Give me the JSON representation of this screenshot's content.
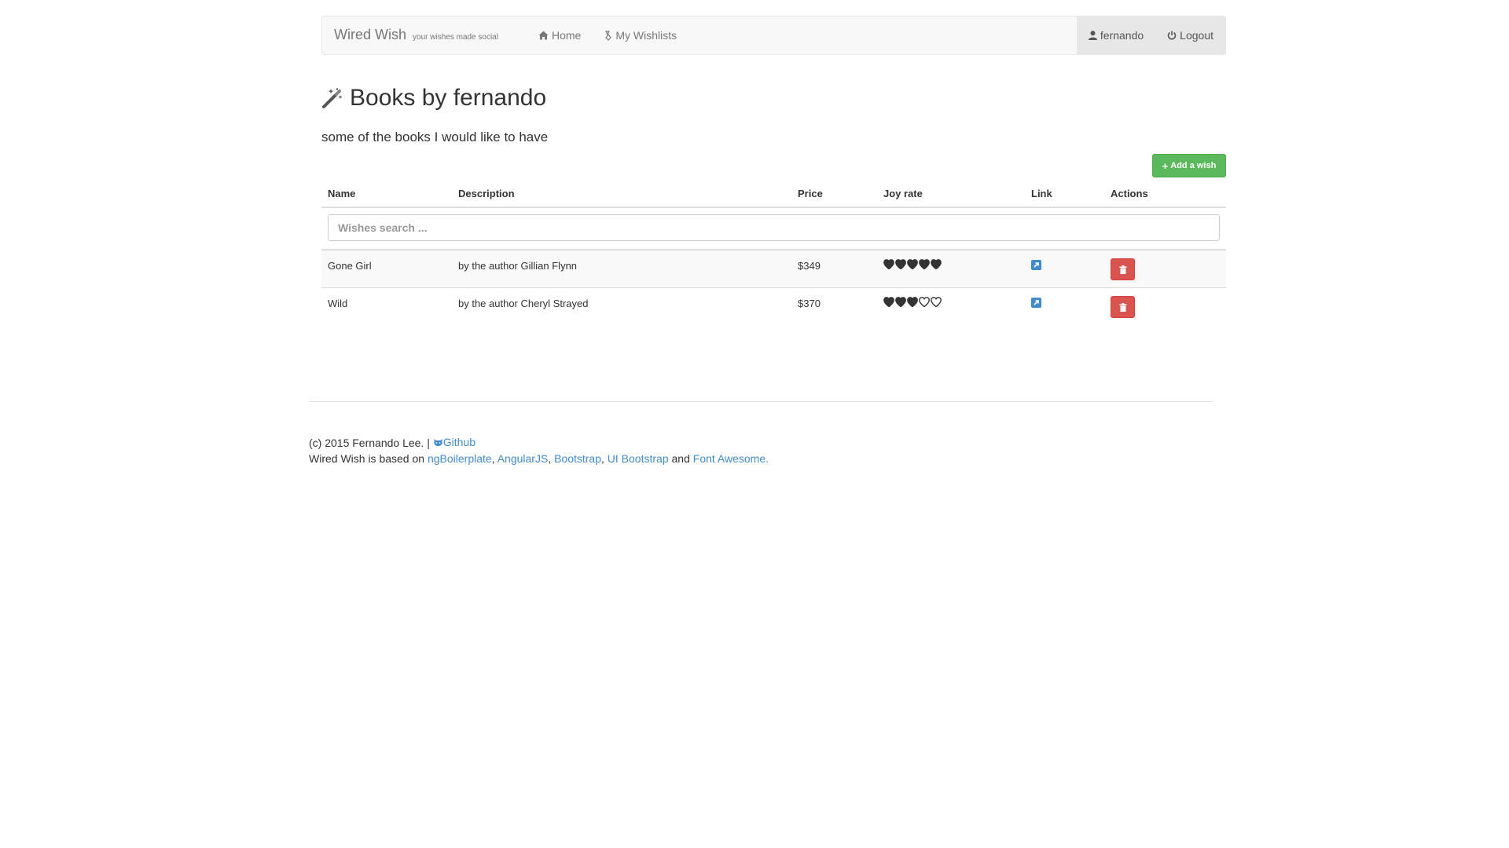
{
  "navbar": {
    "brand": "Wired Wish",
    "tagline": "your wishes made social",
    "home": "Home",
    "my_wishlists": "My Wishlists",
    "user": "fernando",
    "logout": "Logout"
  },
  "page": {
    "title": "Books by fernando",
    "description": "some of the books I would like to have",
    "add_button": "Add a wish"
  },
  "table": {
    "headers": {
      "name": "Name",
      "description": "Description",
      "price": "Price",
      "joy_rate": "Joy rate",
      "link": "Link",
      "actions": "Actions"
    },
    "search_placeholder": "Wishes search ...",
    "rows": [
      {
        "name": "Gone Girl",
        "description": "by the author Gillian Flynn",
        "price": "$349",
        "joy_rate": 5
      },
      {
        "name": "Wild",
        "description": "by the author Cheryl Strayed",
        "price": "$370",
        "joy_rate": 3
      }
    ]
  },
  "footer": {
    "copyright": "(c) 2015 Fernando Lee. |",
    "github": "Github",
    "based_on": "Wired Wish is based on",
    "ngboilerplate": "ngBoilerplate",
    "angularjs": "AngularJS",
    "bootstrap": "Bootstrap",
    "ui_bootstrap": "UI Bootstrap",
    "and": "and",
    "font_awesome": "Font Awesome."
  },
  "colors": {
    "success": "#5cb85c",
    "danger": "#d9534f",
    "link": "#428bca"
  }
}
